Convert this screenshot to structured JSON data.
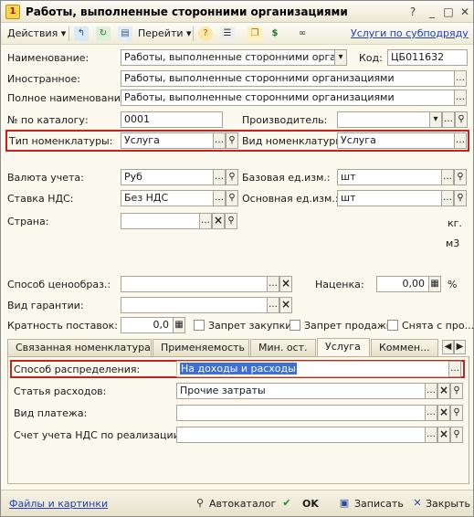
{
  "window": {
    "title": "Работы, выполненные сторонними организациями"
  },
  "toolbar": {
    "actions_label": "Действия",
    "goto_label": "Перейти",
    "link_label": "Услуги по субподряду"
  },
  "form": {
    "name": {
      "label": "Наименование:",
      "value": "Работы, выполненные сторонними организа"
    },
    "code": {
      "label": "Код:",
      "value": "ЦБ011632"
    },
    "foreign": {
      "label": "Иностранное:",
      "value": "Работы, выполненные сторонними организациями"
    },
    "full_name": {
      "label": "Полное наименование:",
      "value": "Работы, выполненные сторонними организациями"
    },
    "catalog_no": {
      "label": "№ по каталогу:",
      "value": "0001"
    },
    "manufacturer": {
      "label": "Производитель:",
      "value": ""
    },
    "nom_type": {
      "label": "Тип номенклатуры:",
      "value": "Услуга"
    },
    "nom_kind": {
      "label": "Вид номенклатуры:",
      "value": "Услуга"
    },
    "currency": {
      "label": "Валюта учета:",
      "value": "Руб"
    },
    "base_unit": {
      "label": "Базовая ед.изм.:",
      "value": "шт"
    },
    "vat_rate": {
      "label": "Ставка НДС:",
      "value": "Без НДС"
    },
    "main_unit": {
      "label": "Основная ед.изм.:",
      "value": "шт"
    },
    "country": {
      "label": "Страна:",
      "value": ""
    },
    "unit_kg": "кг.",
    "unit_m3": "м3",
    "pricing": {
      "label": "Способ ценообраз.:",
      "value": ""
    },
    "markup": {
      "label": "Наценка:",
      "value": "0,00",
      "unit": "%"
    },
    "warranty": {
      "label": "Вид гарантии:",
      "value": ""
    },
    "multiplicity": {
      "label": "Кратность поставок:",
      "value": "0,0"
    },
    "ban_purchase": "Запрет закупки",
    "ban_sale": "Запрет продажи",
    "discontinued": "Снята с про..."
  },
  "tabs": [
    {
      "label": "Связанная номенклатура"
    },
    {
      "label": "Применяемость"
    },
    {
      "label": "Мин. ост."
    },
    {
      "label": "Услуга"
    },
    {
      "label": "Коммен..."
    }
  ],
  "service": {
    "distribution": {
      "label": "Способ распределения:",
      "value": "На доходы и расходы"
    },
    "expense_item": {
      "label": "Статья расходов:",
      "value": "Прочие затраты"
    },
    "payment_type": {
      "label": "Вид платежа:",
      "value": ""
    },
    "vat_account": {
      "label": "Счет учета НДС по реализации:",
      "value": ""
    }
  },
  "bottom": {
    "files_link": "Файлы и картинки",
    "autocatalog": "Автокаталог",
    "ok": "OK",
    "save": "Записать",
    "close": "Закрыть"
  }
}
